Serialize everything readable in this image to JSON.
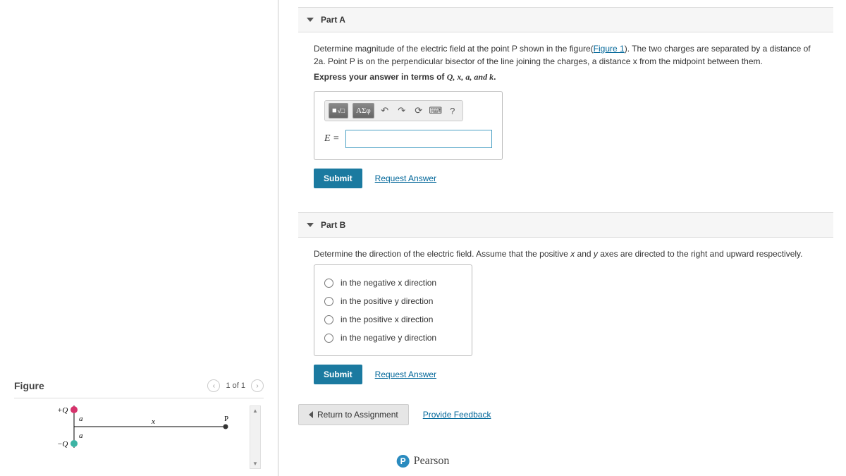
{
  "partA": {
    "title": "Part A",
    "prompt_pre": "Determine magnitude of the electric field at the point P shown in the figure(",
    "figure_link": "Figure 1",
    "prompt_post": "). The two charges are separated by a distance of 2a. Point P is on the perpendicular bisector of the line joining the charges, a distance x from the midpoint between them.",
    "express_pre": "Express your answer in terms of ",
    "vars": "Q, x, a, and k",
    "express_post": ".",
    "eq_label": "E =",
    "symbols_btn": "ΑΣφ",
    "submit": "Submit",
    "request": "Request Answer"
  },
  "partB": {
    "title": "Part B",
    "prompt": "Determine the direction of the electric field. Assume that the positive x and y axes are directed to the right and upward respectively.",
    "options": [
      "in the negative x direction",
      "in the positive y direction",
      "in the positive x direction",
      "in the negative y direction"
    ],
    "submit": "Submit",
    "request": "Request Answer"
  },
  "bottom": {
    "return": "Return to Assignment",
    "feedback": "Provide Feedback"
  },
  "figure": {
    "title": "Figure",
    "pager": "1 of 1",
    "plusQ": "+Q",
    "minusQ": "−Q",
    "a": "a",
    "x": "x",
    "P": "P"
  },
  "brand": "Pearson",
  "icons": {
    "undo": "↶",
    "redo": "↷",
    "reset": "⟳",
    "keyboard": "⌨",
    "help": "?",
    "tmpl": "■"
  }
}
